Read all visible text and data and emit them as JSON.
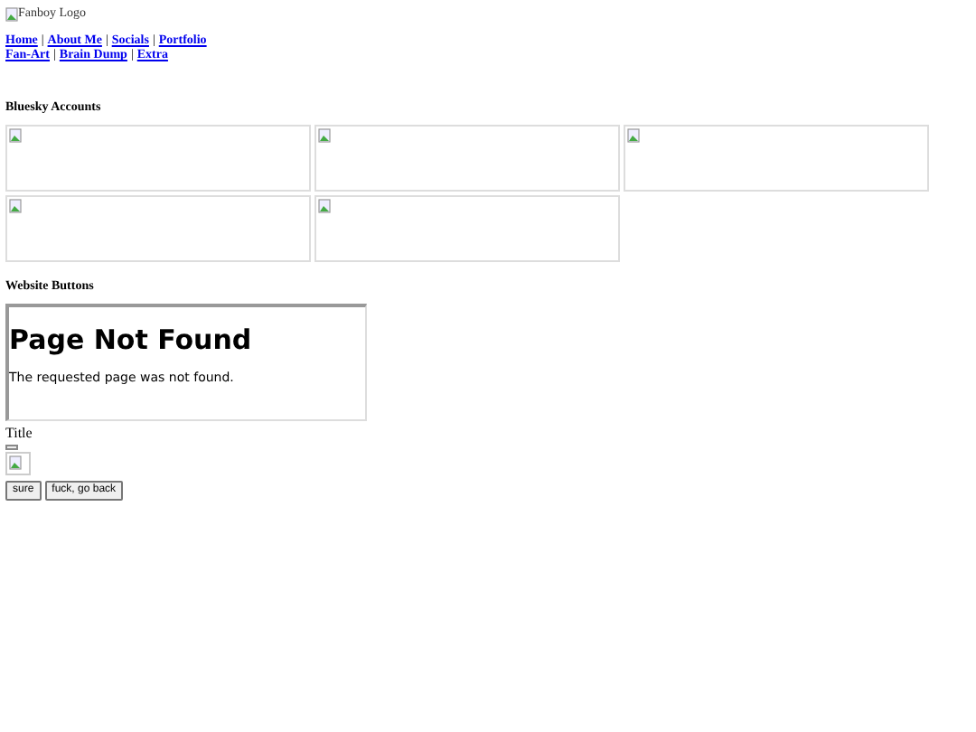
{
  "logo": {
    "alt": "Fanboy Logo"
  },
  "nav_rows": [
    {
      "items": [
        {
          "kind": "link",
          "text": "Home"
        },
        {
          "kind": "separator",
          "text": "|"
        },
        {
          "kind": "link",
          "text": "About Me"
        },
        {
          "kind": "separator",
          "text": "|"
        },
        {
          "kind": "link",
          "text": "Socials"
        },
        {
          "kind": "separator",
          "text": "|"
        },
        {
          "kind": "link",
          "text": "Portfolio"
        }
      ]
    },
    {
      "items": [
        {
          "kind": "link",
          "text": "Fan-Art"
        },
        {
          "kind": "separator",
          "text": "|"
        },
        {
          "kind": "link",
          "text": "Brain Dump"
        },
        {
          "kind": "separator",
          "text": "|"
        },
        {
          "kind": "link",
          "text": "Extra"
        }
      ]
    }
  ],
  "bluesky_accounts": {
    "heading": "Bluesky Accounts",
    "cards": [
      {
        "kind": "broken-image"
      },
      {
        "kind": "broken-image"
      },
      {
        "kind": "broken-image"
      },
      {
        "kind": "broken-image"
      },
      {
        "kind": "broken-image"
      }
    ]
  },
  "website_buttons": {
    "heading": "Website Buttons",
    "frame": {
      "title": "Page Not Found",
      "message": "The requested page was not found."
    }
  },
  "title_label": "Title",
  "buttons": [
    {
      "label": "sure"
    },
    {
      "label": "fuck, go back"
    }
  ]
}
